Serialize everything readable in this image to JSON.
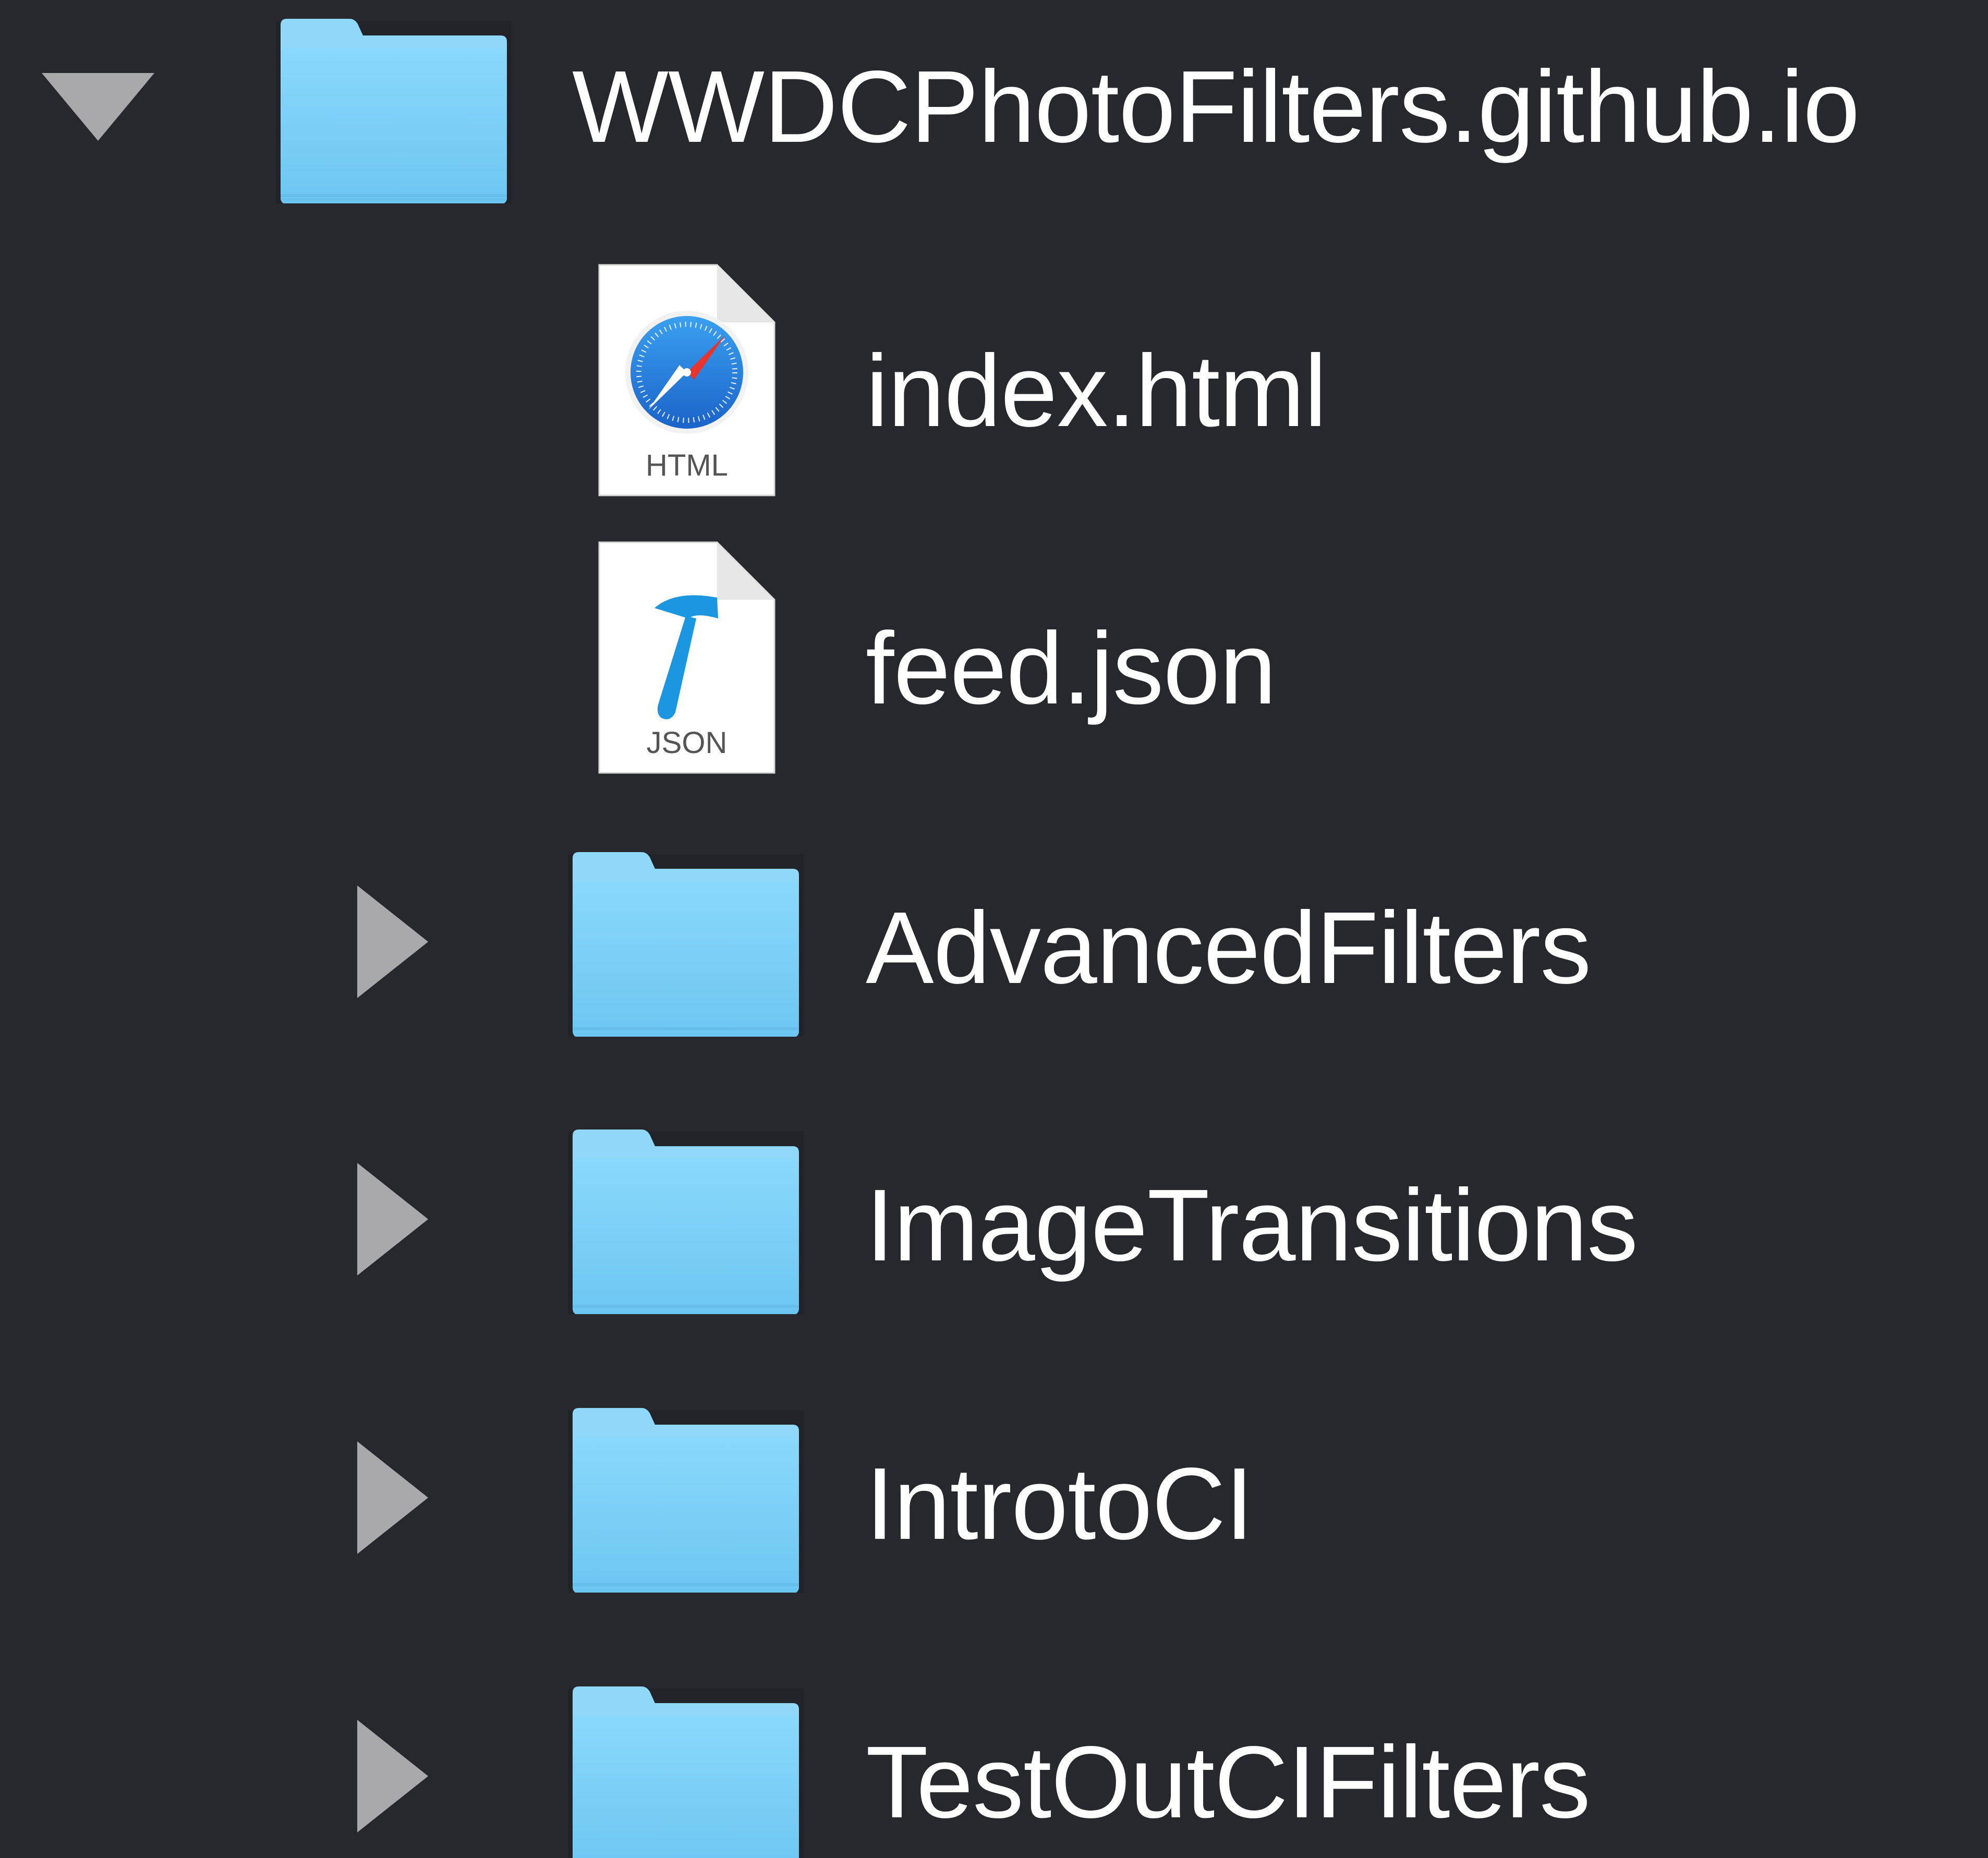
{
  "file_tree": {
    "root": {
      "name": "WWDCPhotoFilters.github.io",
      "icon": "folder-icon",
      "expanded": true
    },
    "children": [
      {
        "name": "index.html",
        "icon": "safari-html-file-icon",
        "badge": "HTML",
        "kind": "file"
      },
      {
        "name": "feed.json",
        "icon": "xcode-json-file-icon",
        "badge": "JSON",
        "kind": "file"
      },
      {
        "name": "AdvancedFilters",
        "icon": "folder-icon",
        "kind": "folder",
        "expanded": false
      },
      {
        "name": "ImageTransitions",
        "icon": "folder-icon",
        "kind": "folder",
        "expanded": false
      },
      {
        "name": "IntrotoCI",
        "icon": "folder-icon",
        "kind": "folder",
        "expanded": false
      },
      {
        "name": "TestOutCIFilters",
        "icon": "folder-icon",
        "kind": "folder",
        "expanded": false
      }
    ]
  },
  "colors": {
    "background": "#27282e",
    "disclosure": "#a9a9ab",
    "folder": "#7ed0f7",
    "folder_tab": "#8fd8fa",
    "text": "#ffffff",
    "safari_blue": "#1e7fd8",
    "hammer_blue": "#1a97e0"
  }
}
